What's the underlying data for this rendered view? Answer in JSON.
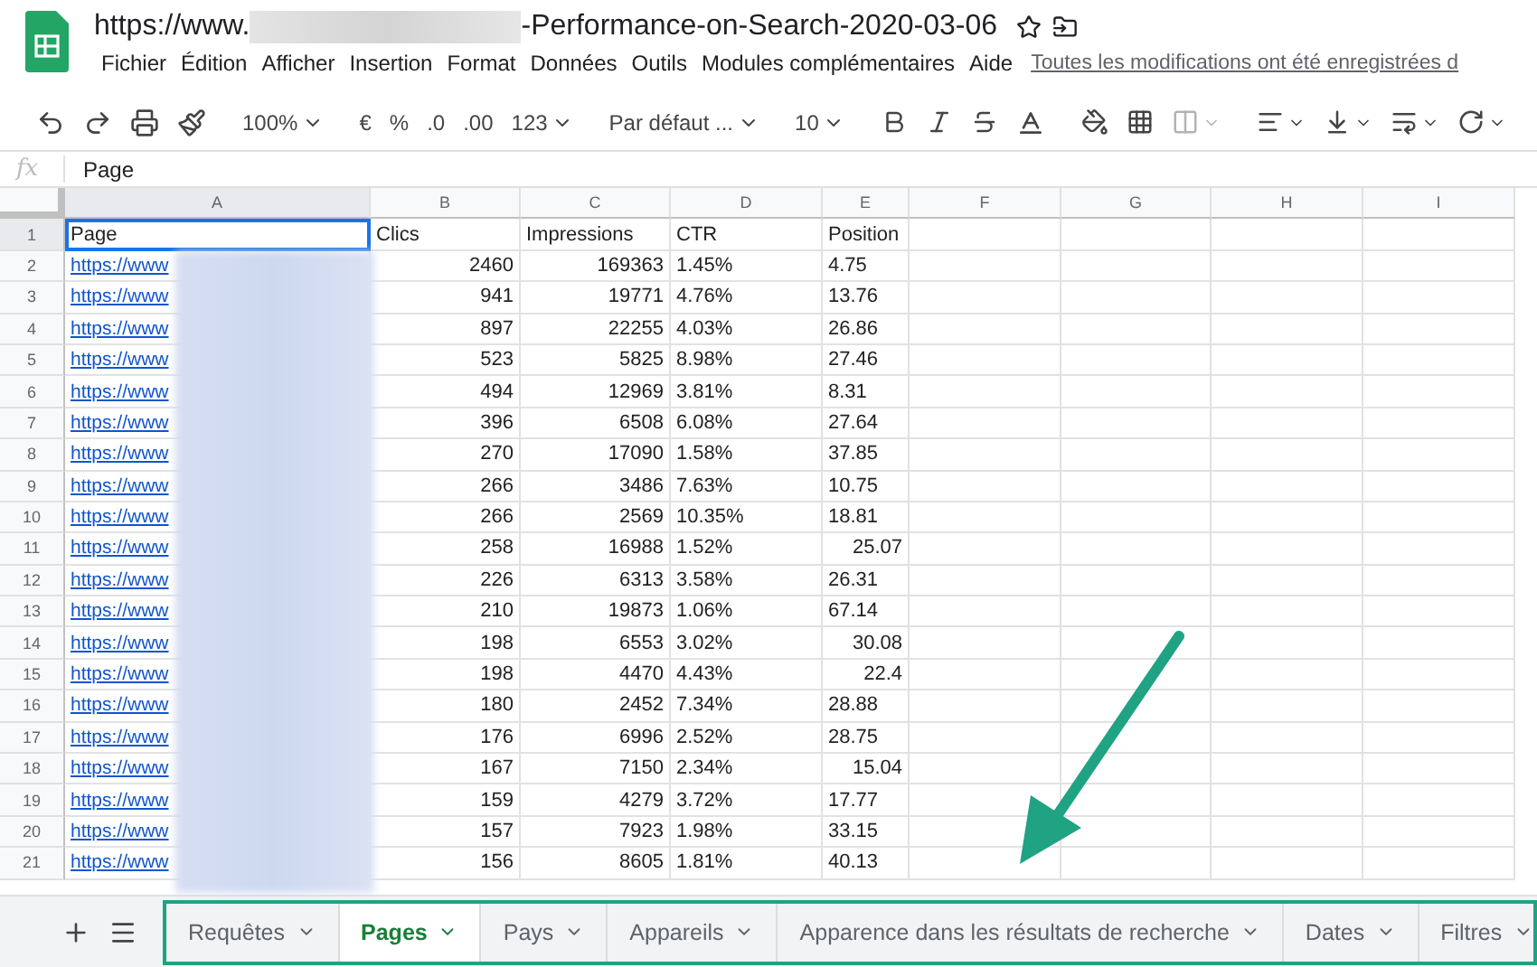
{
  "title": {
    "prefix": "https://www.",
    "suffix": "-Performance-on-Search-2020-03-06"
  },
  "menu": [
    "Fichier",
    "Édition",
    "Afficher",
    "Insertion",
    "Format",
    "Données",
    "Outils",
    "Modules complémentaires",
    "Aide"
  ],
  "save_status": "Toutes les modifications ont été enregistrées d",
  "toolbar": {
    "zoom": "100%",
    "currency": "€",
    "percent": "%",
    "decimal_less": ".0",
    "decimal_more": ".00",
    "format": "123",
    "font": "Par défaut ...",
    "size": "10"
  },
  "formula_bar": {
    "label": "fx",
    "value": "Page"
  },
  "columns": [
    "A",
    "B",
    "C",
    "D",
    "E",
    "F",
    "G",
    "H",
    "I"
  ],
  "rows": [
    {
      "n": "1",
      "kind": "header",
      "selected": true,
      "cells": [
        "Page",
        "Clics",
        "Impressions",
        "CTR",
        "Position"
      ],
      "position_right": false
    },
    {
      "n": "2",
      "kind": "data",
      "selected": false,
      "cells": [
        "https://www",
        "2460",
        "169363",
        "1.45%",
        "4.75"
      ],
      "position_right": false
    },
    {
      "n": "3",
      "kind": "data",
      "selected": false,
      "cells": [
        "https://www",
        "941",
        "19771",
        "4.76%",
        "13.76"
      ],
      "position_right": false
    },
    {
      "n": "4",
      "kind": "data",
      "selected": false,
      "cells": [
        "https://www",
        "897",
        "22255",
        "4.03%",
        "26.86"
      ],
      "position_right": false
    },
    {
      "n": "5",
      "kind": "data",
      "selected": false,
      "cells": [
        "https://www",
        "523",
        "5825",
        "8.98%",
        "27.46"
      ],
      "position_right": false
    },
    {
      "n": "6",
      "kind": "data",
      "selected": false,
      "cells": [
        "https://www",
        "494",
        "12969",
        "3.81%",
        "8.31"
      ],
      "position_right": false
    },
    {
      "n": "7",
      "kind": "data",
      "selected": false,
      "cells": [
        "https://www",
        "396",
        "6508",
        "6.08%",
        "27.64"
      ],
      "position_right": false
    },
    {
      "n": "8",
      "kind": "data",
      "selected": false,
      "cells": [
        "https://www",
        "270",
        "17090",
        "1.58%",
        "37.85"
      ],
      "position_right": false
    },
    {
      "n": "9",
      "kind": "data",
      "selected": false,
      "cells": [
        "https://www",
        "266",
        "3486",
        "7.63%",
        "10.75"
      ],
      "position_right": false
    },
    {
      "n": "10",
      "kind": "data",
      "selected": false,
      "cells": [
        "https://www",
        "266",
        "2569",
        "10.35%",
        "18.81"
      ],
      "position_right": false
    },
    {
      "n": "11",
      "kind": "data",
      "selected": false,
      "cells": [
        "https://www",
        "258",
        "16988",
        "1.52%",
        "25.07"
      ],
      "position_right": true
    },
    {
      "n": "12",
      "kind": "data",
      "selected": false,
      "cells": [
        "https://www",
        "226",
        "6313",
        "3.58%",
        "26.31"
      ],
      "position_right": false
    },
    {
      "n": "13",
      "kind": "data",
      "selected": false,
      "cells": [
        "https://www",
        "210",
        "19873",
        "1.06%",
        "67.14"
      ],
      "position_right": false
    },
    {
      "n": "14",
      "kind": "data",
      "selected": false,
      "cells": [
        "https://www",
        "198",
        "6553",
        "3.02%",
        "30.08"
      ],
      "position_right": true
    },
    {
      "n": "15",
      "kind": "data",
      "selected": false,
      "cells": [
        "https://www",
        "198",
        "4470",
        "4.43%",
        "22.4"
      ],
      "position_right": true
    },
    {
      "n": "16",
      "kind": "data",
      "selected": false,
      "cells": [
        "https://www",
        "180",
        "2452",
        "7.34%",
        "28.88"
      ],
      "position_right": false
    },
    {
      "n": "17",
      "kind": "data",
      "selected": false,
      "cells": [
        "https://www",
        "176",
        "6996",
        "2.52%",
        "28.75"
      ],
      "position_right": false
    },
    {
      "n": "18",
      "kind": "data",
      "selected": false,
      "cells": [
        "https://www",
        "167",
        "7150",
        "2.34%",
        "15.04"
      ],
      "position_right": true
    },
    {
      "n": "19",
      "kind": "data",
      "selected": false,
      "cells": [
        "https://www",
        "159",
        "4279",
        "3.72%",
        "17.77"
      ],
      "position_right": false
    },
    {
      "n": "20",
      "kind": "data",
      "selected": false,
      "cells": [
        "https://www",
        "157",
        "7923",
        "1.98%",
        "33.15"
      ],
      "position_right": false
    },
    {
      "n": "21",
      "kind": "data",
      "selected": false,
      "cells": [
        "https://www",
        "156",
        "8605",
        "1.81%",
        "40.13"
      ],
      "position_right": false
    }
  ],
  "tabs": [
    {
      "label": "Requêtes",
      "selected": false
    },
    {
      "label": "Pages",
      "selected": true
    },
    {
      "label": "Pays",
      "selected": false
    },
    {
      "label": "Appareils",
      "selected": false
    },
    {
      "label": "Apparence dans les résultats de recherche",
      "selected": false
    },
    {
      "label": "Dates",
      "selected": false
    },
    {
      "label": "Filtres",
      "selected": false
    }
  ]
}
